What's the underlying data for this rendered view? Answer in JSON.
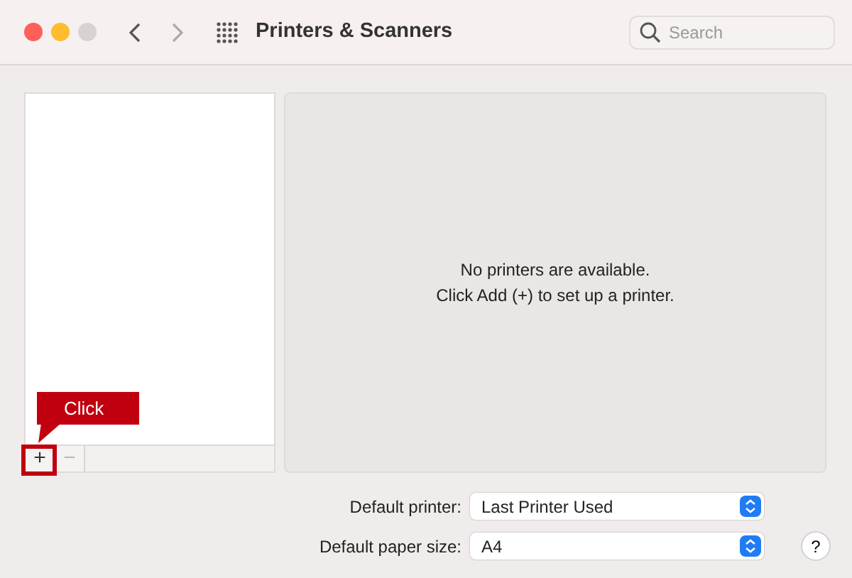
{
  "window": {
    "title": "Printers & Scanners"
  },
  "traffic_lights": [
    {
      "kind": "close",
      "disabled": false
    },
    {
      "kind": "minimize",
      "disabled": false
    },
    {
      "kind": "zoom",
      "disabled": true
    }
  ],
  "nav_buttons": [
    {
      "kind": "back",
      "disabled": false
    },
    {
      "kind": "forward",
      "disabled": true
    }
  ],
  "search": {
    "placeholder": "Search"
  },
  "printer_list": {
    "buttons": [
      {
        "label": "+",
        "disabled": false
      },
      {
        "label": "−",
        "disabled": true
      }
    ]
  },
  "detail": {
    "message_lines": [
      "No printers are available.",
      "Click Add (+) to set up a printer."
    ]
  },
  "settings": [
    {
      "label": "Default printer:",
      "value": "Last Printer Used"
    },
    {
      "label": "Default paper size:",
      "value": "A4"
    }
  ],
  "help_button": {
    "label": "?"
  },
  "annotation": {
    "callout": "Click"
  }
}
